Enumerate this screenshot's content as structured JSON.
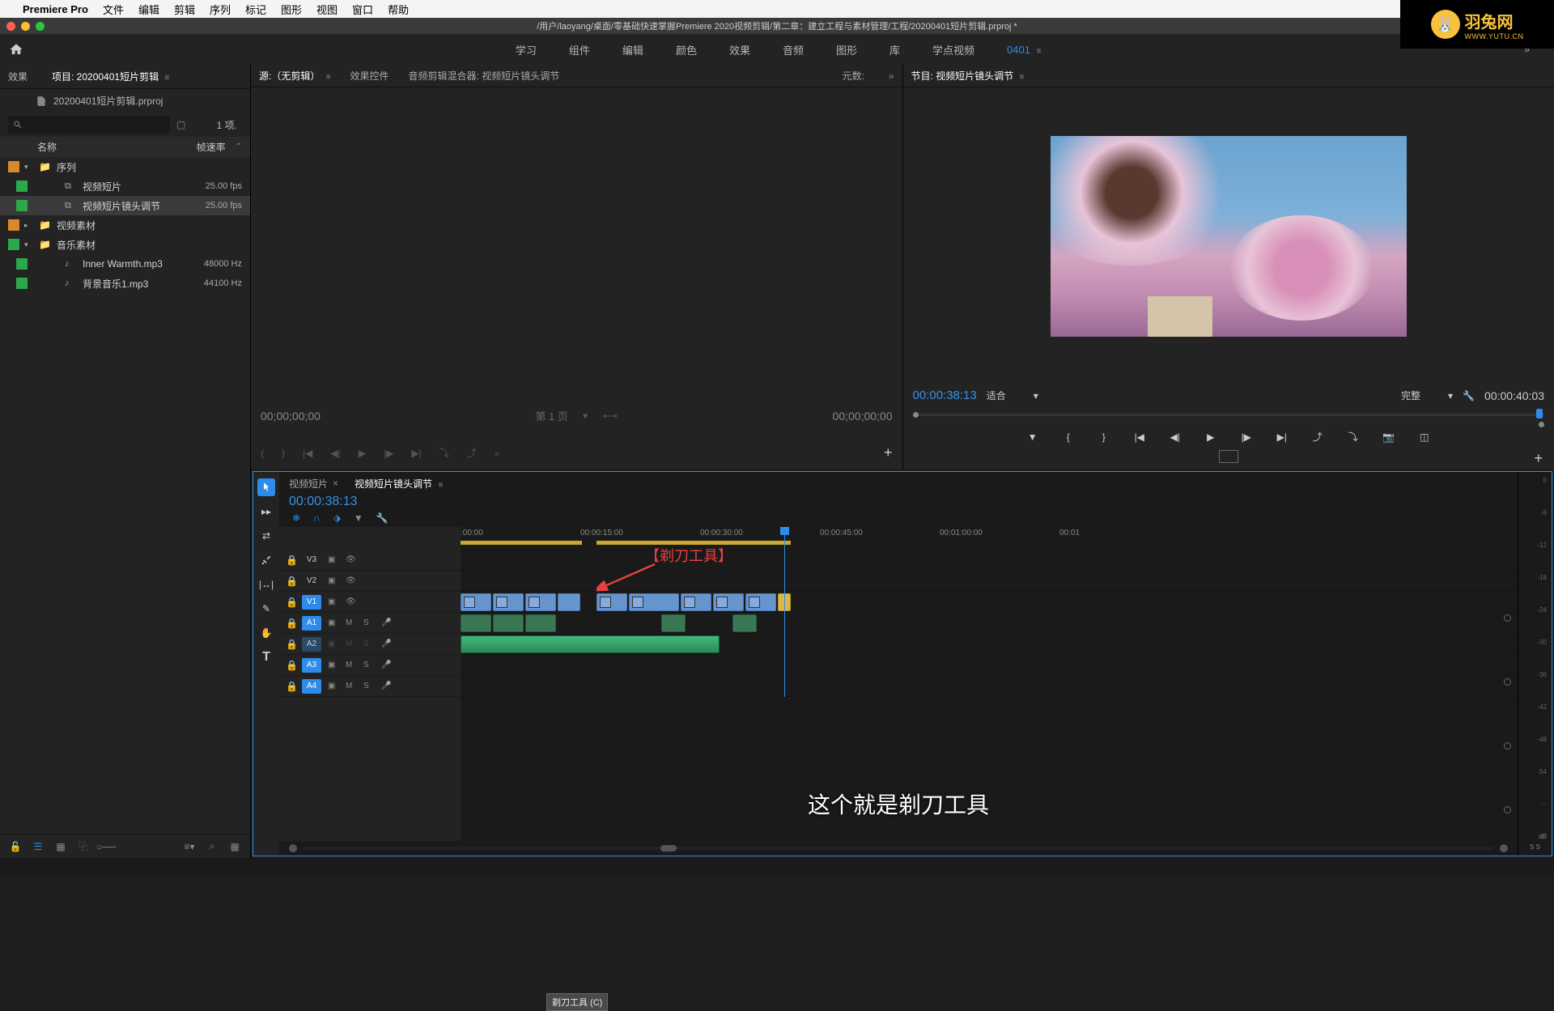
{
  "mac_menu": {
    "app": "Premiere Pro",
    "items": [
      "文件",
      "编辑",
      "剪辑",
      "序列",
      "标记",
      "图形",
      "视图",
      "窗口",
      "帮助"
    ]
  },
  "path": "/用户/laoyang/桌面/零基础快速掌握Premiere 2020视频剪辑/第二章：建立工程与素材管理/工程/20200401短片剪辑.prproj *",
  "workspace": {
    "tabs": [
      "学习",
      "组件",
      "编辑",
      "颜色",
      "效果",
      "音频",
      "图形",
      "库",
      "学点视频",
      "0401"
    ],
    "active": "0401"
  },
  "watermark": {
    "main": "羽兔网",
    "sub": "WWW.YUTU.CN"
  },
  "project": {
    "effects_tab": "效果",
    "project_tab": "项目: 20200401短片剪辑",
    "file": "20200401短片剪辑.prproj",
    "count": "1 项.",
    "col_name": "名称",
    "col_rate": "帧速率",
    "items": [
      {
        "type": "folder",
        "label": "序列",
        "color": "#d88a2a",
        "expand": "▾",
        "indent": 0
      },
      {
        "type": "seq",
        "label": "视频短片",
        "rate": "25.00 fps",
        "color": "#2aa84a",
        "indent": 2
      },
      {
        "type": "seq",
        "label": "视频短片镜头调节",
        "rate": "25.00 fps",
        "color": "#2aa84a",
        "indent": 2,
        "sel": true
      },
      {
        "type": "folder",
        "label": "视频素材",
        "color": "#d88a2a",
        "expand": "▸",
        "indent": 0
      },
      {
        "type": "folder",
        "label": "音乐素材",
        "color": "#2aa84a",
        "expand": "▾",
        "indent": 0
      },
      {
        "type": "audio",
        "label": "Inner Warmth.mp3",
        "rate": "48000 Hz",
        "color": "#2aa84a",
        "indent": 2
      },
      {
        "type": "audio",
        "label": "背景音乐1.mp3",
        "rate": "44100 Hz",
        "color": "#2aa84a",
        "indent": 2
      }
    ]
  },
  "source": {
    "tabs": [
      "源:（无剪辑）",
      "效果控件",
      "音频剪辑混合器: 视频短片镜头调节"
    ],
    "meta": "元数:",
    "tc_left": "00;00;00;00",
    "page": "第 1 页",
    "tc_right": "00;00;00;00"
  },
  "program": {
    "title": "节目: 视频短片镜头调节",
    "tc": "00:00:38:13",
    "fit": "适合",
    "full": "完整",
    "dur": "00:00:40:03"
  },
  "timeline": {
    "tabs": [
      "视频短片",
      "视频短片镜头调节"
    ],
    "active": "视频短片镜头调节",
    "tc": "00:00:38:13",
    "ruler": [
      ":00:00",
      "00:00:15:00",
      "00:00:30:00",
      "00:00:45:00",
      "00:01:00:00",
      "00:01"
    ],
    "tracks_v": [
      "V3",
      "V2",
      "V1"
    ],
    "tracks_a": [
      "A1",
      "A2",
      "A3",
      "A4"
    ],
    "tooltip": "剃刀工具 (C)",
    "annotation": "【剃刀工具】",
    "subtitle": "这个就是剃刀工具"
  },
  "meter": {
    "scale": [
      "0",
      "-6",
      "-12",
      "-18",
      "-24",
      "-30",
      "-36",
      "-42",
      "-48",
      "-54",
      "- -"
    ],
    "foot": "S   S",
    "db": "dB"
  }
}
